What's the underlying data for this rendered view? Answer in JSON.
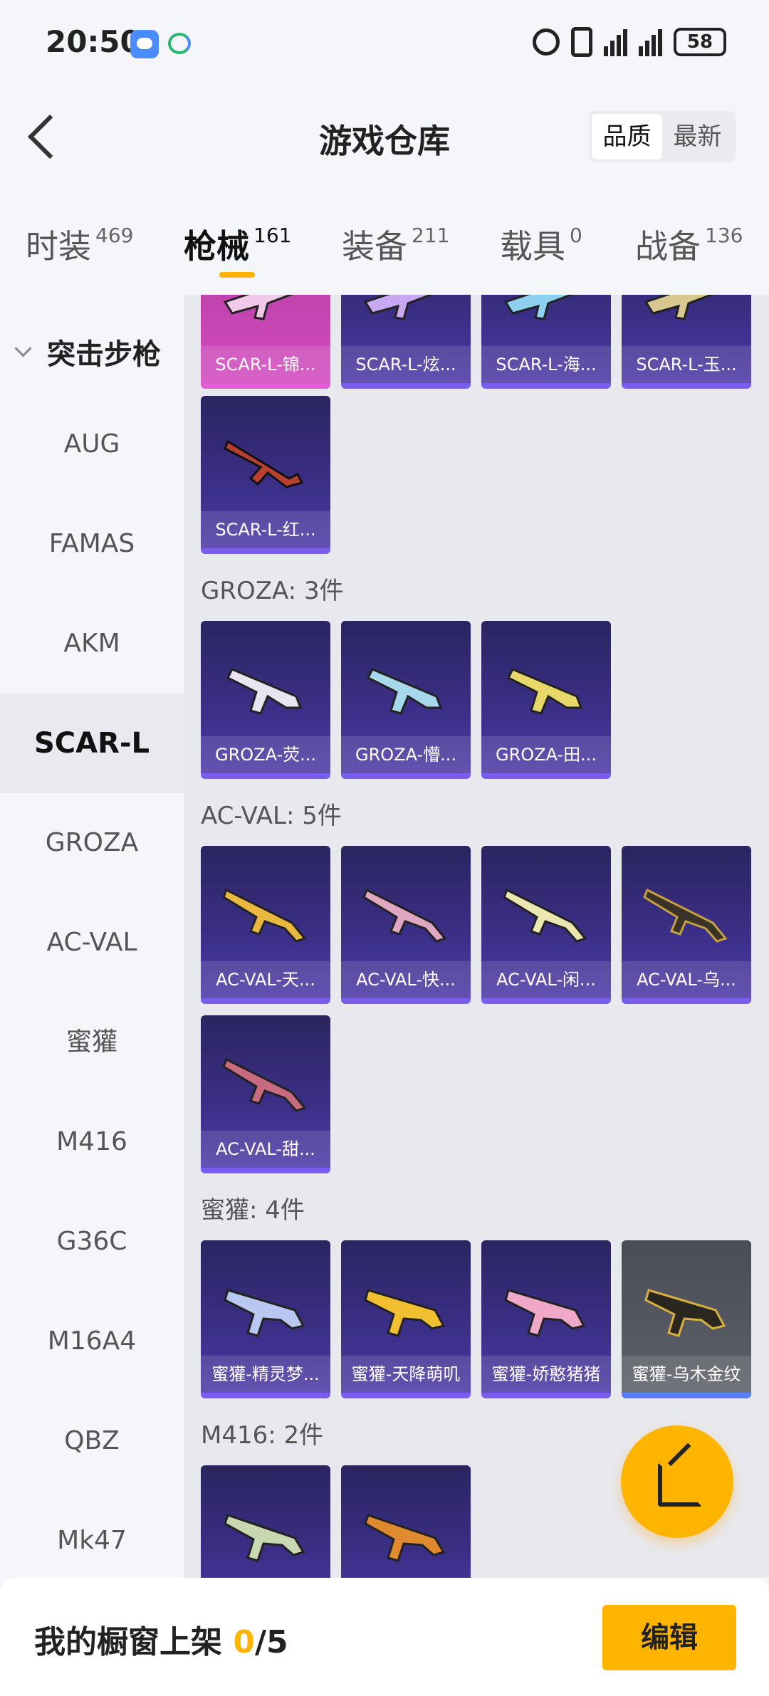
{
  "status_bar": {
    "time": "20:50",
    "battery": "58",
    "icons": [
      "chat-app-icon",
      "sync-app-icon",
      "alarm-icon",
      "vibrate-icon",
      "signal-5g-icon",
      "signal-5g-icon",
      "battery-icon"
    ]
  },
  "header": {
    "title": "游戏仓库",
    "sort": {
      "quality": "品质",
      "latest": "最新"
    }
  },
  "tabs": [
    {
      "label": "时装",
      "count": "469"
    },
    {
      "label": "枪械",
      "count": "161"
    },
    {
      "label": "装备",
      "count": "211"
    },
    {
      "label": "载具",
      "count": "0"
    },
    {
      "label": "战备",
      "count": "136"
    }
  ],
  "sidebar": {
    "group": "突击步枪",
    "items": [
      "AUG",
      "FAMAS",
      "AKM",
      "SCAR-L",
      "GROZA",
      "AC-VAL",
      "蜜獾",
      "M416",
      "G36C",
      "M16A4",
      "QBZ",
      "Mk47"
    ]
  },
  "content": {
    "scar_top_row": [
      "SCAR-L-锦...",
      "SCAR-L-炫...",
      "SCAR-L-海...",
      "SCAR-L-玉..."
    ],
    "scar_second_row": [
      "SCAR-L-红..."
    ],
    "groza": {
      "title": "GROZA: 3件",
      "items": [
        "GROZA-荧...",
        "GROZA-懵...",
        "GROZA-田..."
      ]
    },
    "acval": {
      "title": "AC-VAL: 5件",
      "items": [
        "AC-VAL-天...",
        "AC-VAL-快...",
        "AC-VAL-闲...",
        "AC-VAL-乌...",
        "AC-VAL-甜..."
      ]
    },
    "honeybadger": {
      "title": "蜜獾: 4件",
      "items": [
        "蜜獾-精灵梦...",
        "蜜獾-天降萌叽",
        "蜜獾-娇憨猪猪",
        "蜜獾-乌木金纹"
      ]
    },
    "m416": {
      "title": "M416: 2件"
    }
  },
  "colors": {
    "accent": "#ffb400",
    "card_purple": "#3c2f88",
    "card_pink": "#d24cc0",
    "card_grey": "#5d6069"
  },
  "bottom": {
    "shelf_label": "我的橱窗上架",
    "shelf_count": "0",
    "shelf_total": "/5",
    "edit": "编辑"
  }
}
